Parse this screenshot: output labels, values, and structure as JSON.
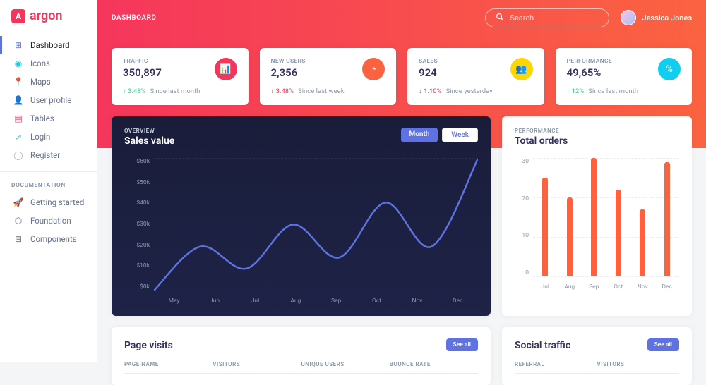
{
  "brand": {
    "glyph": "A",
    "text": "argon"
  },
  "sidebar": {
    "items": [
      {
        "label": "Dashboard",
        "icon": "⊞",
        "color": "#5e72e4"
      },
      {
        "label": "Icons",
        "icon": "◉",
        "color": "#11cdef"
      },
      {
        "label": "Maps",
        "icon": "📍",
        "color": "#fb6340"
      },
      {
        "label": "User profile",
        "icon": "👤",
        "color": "#ffd600"
      },
      {
        "label": "Tables",
        "icon": "▤",
        "color": "#f5365c"
      },
      {
        "label": "Login",
        "icon": "↗",
        "color": "#11cdef"
      },
      {
        "label": "Register",
        "icon": "◯",
        "color": "#adb5bd"
      }
    ],
    "doc_heading": "DOCUMENTATION",
    "docs": [
      {
        "label": "Getting started",
        "icon": "🚀"
      },
      {
        "label": "Foundation",
        "icon": "⬡"
      },
      {
        "label": "Components",
        "icon": "⊟"
      }
    ]
  },
  "header": {
    "title": "DASHBOARD",
    "search_placeholder": "Search",
    "user_name": "Jessica Jones"
  },
  "stats": [
    {
      "label": "TRAFFIC",
      "value": "350,897",
      "delta": "3.48%",
      "dir": "up",
      "since": "Since last month",
      "icon": "📊",
      "bg": "#f5365c"
    },
    {
      "label": "NEW USERS",
      "value": "2,356",
      "delta": "3.48%",
      "dir": "down",
      "since": "Since last week",
      "icon": "◔",
      "bg": "#fb6340"
    },
    {
      "label": "SALES",
      "value": "924",
      "delta": "1.10%",
      "dir": "down",
      "since": "Since yesterday",
      "icon": "👥",
      "bg": "#ffd600"
    },
    {
      "label": "PERFORMANCE",
      "value": "49,65%",
      "delta": "12%",
      "dir": "up",
      "since": "Since last month",
      "icon": "%",
      "bg": "#11cdef"
    }
  ],
  "sales": {
    "overline": "OVERVIEW",
    "title": "Sales value",
    "toggle": {
      "month": "Month",
      "week": "Week"
    },
    "y_labels": [
      "$60k",
      "$50k",
      "$40k",
      "$30k",
      "$20k",
      "$10k",
      "$0k"
    ]
  },
  "orders": {
    "overline": "PERFORMANCE",
    "title": "Total orders",
    "y_labels": [
      "30",
      "20",
      "10",
      "0"
    ]
  },
  "visits": {
    "title": "Page visits",
    "see_all": "See all",
    "cols": [
      "PAGE NAME",
      "VISITORS",
      "UNIQUE USERS",
      "BOUNCE RATE"
    ]
  },
  "social": {
    "title": "Social traffic",
    "see_all": "See all",
    "cols": [
      "REFERRAL",
      "VISITORS"
    ]
  },
  "chart_data": [
    {
      "type": "line",
      "title": "Sales value",
      "categories": [
        "May",
        "Jun",
        "Jul",
        "Aug",
        "Sep",
        "Oct",
        "Nov",
        "Dec"
      ],
      "values": [
        0,
        20,
        10,
        30,
        15,
        40,
        20,
        60
      ],
      "xlabel": "",
      "ylabel": "",
      "ylim": [
        0,
        60
      ],
      "unit": "$ thousands"
    },
    {
      "type": "bar",
      "title": "Total orders",
      "categories": [
        "Jul",
        "Aug",
        "Sep",
        "Oct",
        "Nov",
        "Dec"
      ],
      "values": [
        25,
        20,
        30,
        22,
        17,
        29
      ],
      "xlabel": "",
      "ylabel": "",
      "ylim": [
        0,
        30
      ]
    }
  ]
}
